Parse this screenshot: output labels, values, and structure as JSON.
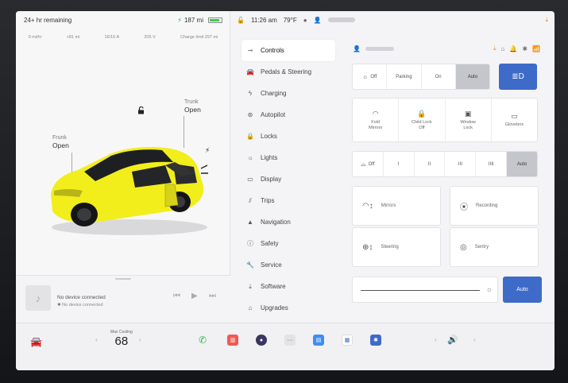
{
  "left": {
    "range_remaining": "24+ hr remaining",
    "odometer": "187 mi",
    "stats": [
      "0 mi/hr",
      "+81 mi",
      "16/16 A",
      "205 V",
      "Charge limit 297 mi"
    ],
    "trunk": {
      "label": "Trunk",
      "state": "Open"
    },
    "frunk": {
      "label": "Frunk",
      "state": "Open"
    },
    "car_color": "#f2ee1c"
  },
  "media": {
    "title": "No device connected",
    "subtitle": "No device connected"
  },
  "status": {
    "time": "11:26 am",
    "temp": "79°F"
  },
  "menu": [
    {
      "label": "Controls",
      "icon": "toggle-icon"
    },
    {
      "label": "Pedals & Steering",
      "icon": "car-icon"
    },
    {
      "label": "Charging",
      "icon": "bolt-icon"
    },
    {
      "label": "Autopilot",
      "icon": "steering-wheel-icon"
    },
    {
      "label": "Locks",
      "icon": "lock-icon"
    },
    {
      "label": "Lights",
      "icon": "sun-icon"
    },
    {
      "label": "Display",
      "icon": "display-icon"
    },
    {
      "label": "Trips",
      "icon": "trips-icon"
    },
    {
      "label": "Navigation",
      "icon": "navigation-icon"
    },
    {
      "label": "Safety",
      "icon": "safety-icon"
    },
    {
      "label": "Service",
      "icon": "wrench-icon"
    },
    {
      "label": "Software",
      "icon": "download-icon"
    },
    {
      "label": "Upgrades",
      "icon": "bag-icon"
    }
  ],
  "controls": {
    "lights": [
      "Off",
      "Parking",
      "On",
      "Auto"
    ],
    "lights_selected": "Auto",
    "tiles": [
      {
        "label": "Fold\nMirrors",
        "icon": "mirror-icon"
      },
      {
        "label": "Child Lock\nOff",
        "icon": "child-lock-icon"
      },
      {
        "label": "Window\nLock",
        "icon": "window-lock-icon"
      },
      {
        "label": "Glovebox",
        "icon": "glovebox-icon"
      }
    ],
    "wipers": [
      "Off",
      "I",
      "II",
      "III",
      "IIII",
      "Auto"
    ],
    "wipers_selected": "Auto",
    "mirrors": "Mirrors",
    "steering": "Steering",
    "recording": "Recording",
    "sentry": "Sentry",
    "brightness_auto": "Auto"
  },
  "dock": {
    "climate_label": "Max Cooling",
    "climate_temp": "68"
  },
  "colors": {
    "accent": "#3e6bc8",
    "selected": "#c4c6cb"
  }
}
